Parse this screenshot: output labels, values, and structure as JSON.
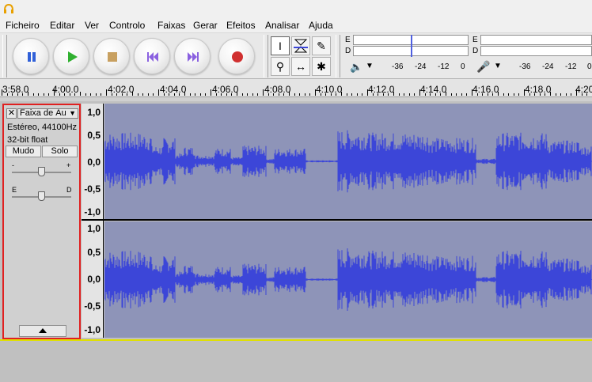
{
  "menu": [
    "Ficheiro",
    "Editar",
    "Ver",
    "Controlo",
    "Faixas",
    "Gerar",
    "Efeitos",
    "Analisar",
    "Ajuda"
  ],
  "transport": [
    "pause",
    "play",
    "stop",
    "skip-start",
    "skip-end",
    "record"
  ],
  "tools": [
    "I",
    "✎",
    "⚲",
    "↔",
    "✱"
  ],
  "meters": {
    "playback": {
      "l": "E",
      "r": "D",
      "ticks": [
        "-36",
        "-24",
        "-12",
        "0"
      ]
    },
    "record": {
      "l": "E",
      "r": "D",
      "ticks": [
        "-36",
        "-24",
        "-12",
        "0"
      ]
    }
  },
  "ruler": [
    "3:58.0",
    "4:00.0",
    "4:02.0",
    "4:04.0",
    "4:06.0",
    "4:08.0",
    "4:10.0",
    "4:12.0",
    "4:14.0",
    "4:16.0",
    "4:18.0",
    "4:20"
  ],
  "track": {
    "name": "Faixa de Áu",
    "format": "Estéreo, 44100Hz",
    "bits": "32-bit float",
    "mute": "Mudo",
    "solo": "Solo",
    "gain_minus": "-",
    "gain_plus": "+",
    "pan_left": "E",
    "pan_right": "D"
  },
  "amp_scale": [
    "1,0",
    "0,5",
    "0,0",
    "-0,5",
    "-1,0"
  ],
  "colors": {
    "waveform": "#3c46d8",
    "wave_bg": "#8e94b8",
    "selection_border": "#e02020"
  }
}
